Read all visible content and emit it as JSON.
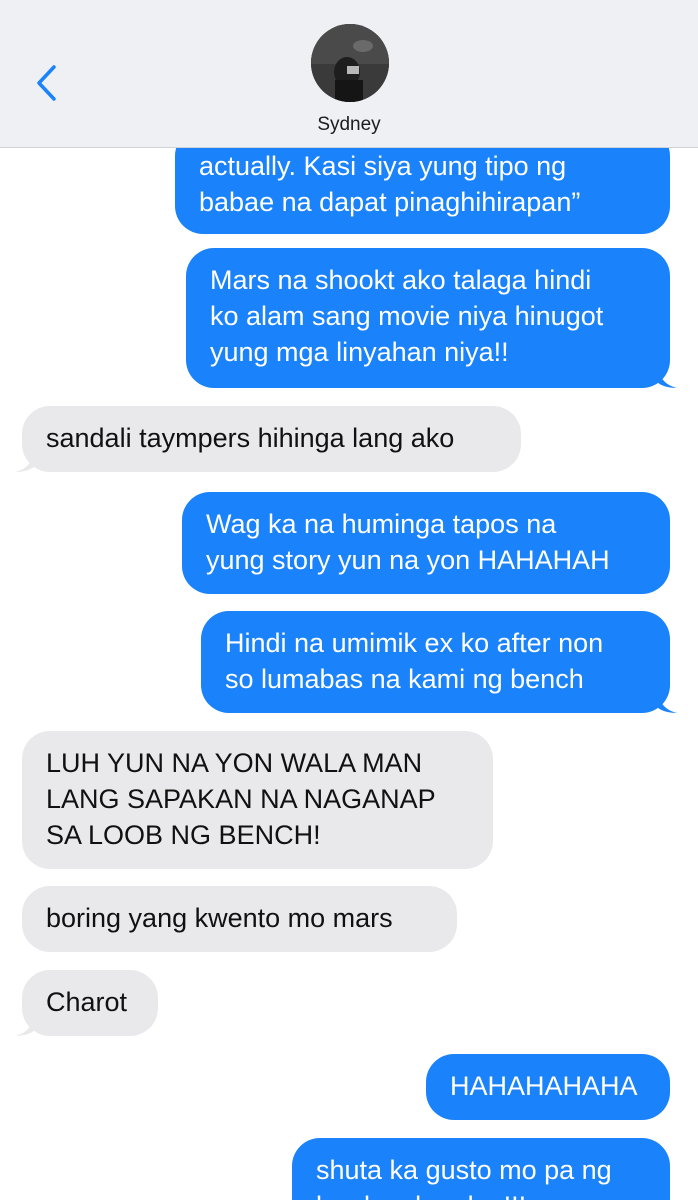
{
  "header": {
    "contact_name": "Sydney"
  },
  "icons": {
    "back": "chevron-left-icon",
    "avatar": "contact-avatar"
  },
  "colors": {
    "outgoing": "#1a82fb",
    "incoming": "#e9e9eb",
    "accent": "#1a82fb"
  },
  "messages": [
    {
      "sender": "me",
      "lines": [
        "actually. Kasi siya yung tipo ng",
        "babae na dapat pinaghihirapan”"
      ]
    },
    {
      "sender": "me",
      "lines": [
        "Mars na shookt ako talaga hindi",
        "ko alam sang movie niya hinugot",
        "yung mga linyahan niya!!"
      ]
    },
    {
      "sender": "them",
      "lines": [
        "sandali taympers hihinga lang ako"
      ]
    },
    {
      "sender": "me",
      "lines": [
        "Wag ka na huminga tapos na",
        "yung story yun na yon HAHAHAH"
      ]
    },
    {
      "sender": "me",
      "lines": [
        "Hindi na umimik ex ko after non",
        "so lumabas na kami ng bench"
      ]
    },
    {
      "sender": "them",
      "lines": [
        "LUH YUN NA YON WALA MAN",
        "LANG SAPAKAN NA NAGANAP",
        "SA LOOB NG BENCH!"
      ]
    },
    {
      "sender": "them",
      "lines": [
        "boring yang kwento mo mars"
      ]
    },
    {
      "sender": "them",
      "lines": [
        "Charot"
      ]
    },
    {
      "sender": "me",
      "lines": [
        "HAHAHAHAHA"
      ]
    },
    {
      "sender": "me",
      "lines": [
        "shuta ka gusto mo pa ng",
        "bardagulan dun!!!"
      ]
    }
  ]
}
